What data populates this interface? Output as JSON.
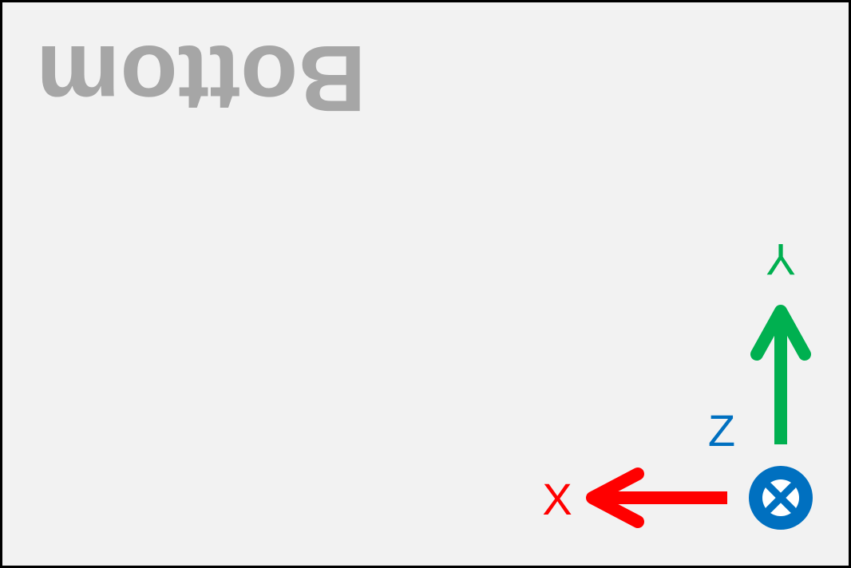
{
  "view": {
    "title": "Bottom",
    "title_color": "#a6a6a6",
    "background": "#f2f2f2",
    "border_color": "#000000"
  },
  "axes": {
    "x": {
      "label": "X",
      "color": "#ff0000",
      "direction": "left"
    },
    "y": {
      "label": "Y",
      "color": "#00b050",
      "direction": "up",
      "label_flipped": true
    },
    "z": {
      "label": "Z",
      "color": "#0070c0",
      "direction": "into-page",
      "symbol": "circle-cross-icon"
    }
  }
}
